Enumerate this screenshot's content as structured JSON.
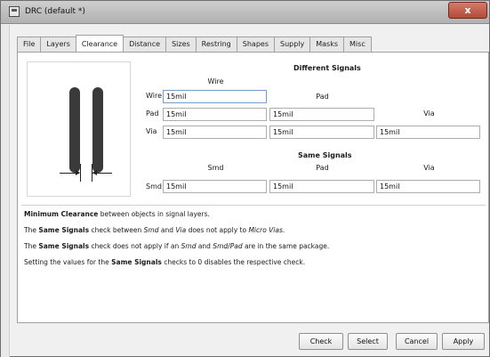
{
  "window": {
    "title": "DRC (default *)",
    "close_glyph": "x"
  },
  "tabs": [
    {
      "label": "File"
    },
    {
      "label": "Layers"
    },
    {
      "label": "Clearance"
    },
    {
      "label": "Distance"
    },
    {
      "label": "Sizes"
    },
    {
      "label": "Restring"
    },
    {
      "label": "Shapes"
    },
    {
      "label": "Supply"
    },
    {
      "label": "Masks"
    },
    {
      "label": "Misc"
    }
  ],
  "active_tab": "Clearance",
  "different_signals": {
    "heading": "Different Signals",
    "col_wire": "Wire",
    "col_pad": "Pad",
    "col_via": "Via",
    "rows": {
      "wire": {
        "label": "Wire",
        "wire": "15mil"
      },
      "pad": {
        "label": "Pad",
        "wire": "15mil",
        "pad": "15mil"
      },
      "via": {
        "label": "Via",
        "wire": "15mil",
        "pad": "15mil",
        "via": "15mil"
      }
    }
  },
  "same_signals": {
    "heading": "Same Signals",
    "col_smd": "Smd",
    "col_pad": "Pad",
    "col_via": "Via",
    "row": {
      "label": "Smd",
      "smd": "15mil",
      "pad": "15mil",
      "via": "15mil"
    }
  },
  "description": {
    "line1_bold": "Minimum Clearance",
    "line1_rest": " between objects in signal layers.",
    "line2_a": "The ",
    "line2_bold": "Same Signals",
    "line2_b": " check between ",
    "line2_i1": "Smd",
    "line2_c": " and ",
    "line2_i2": "Via",
    "line2_d": " does not apply to ",
    "line2_i3": "Micro Vias",
    "line2_e": ".",
    "line3_a": "The ",
    "line3_bold": "Same Signals",
    "line3_b": " check does not apply if an ",
    "line3_i1": "Smd",
    "line3_c": " and ",
    "line3_i2": "Smd/Pad",
    "line3_d": " are in the same package.",
    "line4_a": "Setting the values for the ",
    "line4_bold": "Same Signals",
    "line4_b": " checks to 0 disables the respective check."
  },
  "footer": {
    "check": "Check",
    "select": "Select",
    "cancel": "Cancel",
    "apply": "Apply"
  }
}
